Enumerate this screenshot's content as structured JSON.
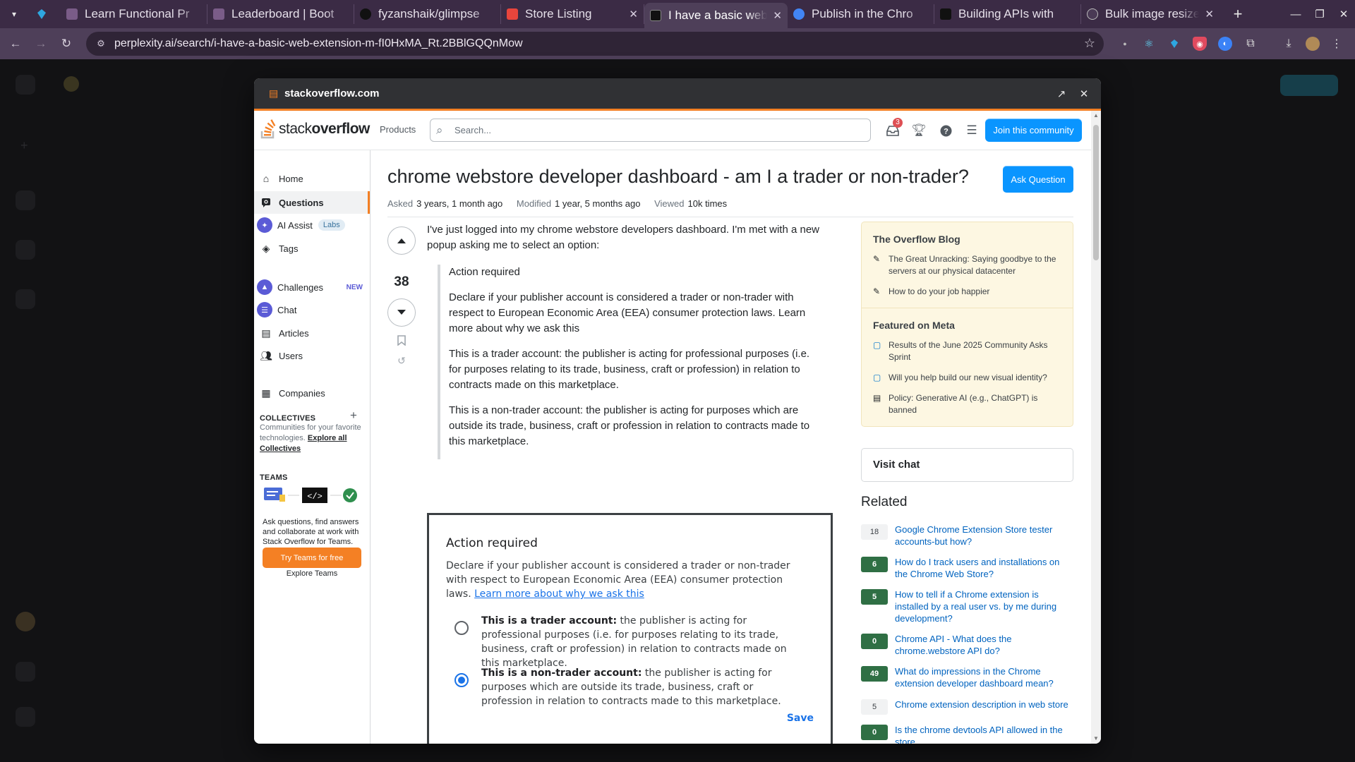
{
  "browser": {
    "tabs": [
      {
        "title": "Learn Functional Pr",
        "color": "#7a5c88"
      },
      {
        "title": "Leaderboard | Boot",
        "color": "#7a5c88"
      },
      {
        "title": "fyzanshaik/glimpse",
        "color": "#111111"
      },
      {
        "title": "Store Listing",
        "color": "#e8453c"
      },
      {
        "title": "I have a basic web",
        "color": "#111111"
      },
      {
        "title": "Publish in the Chro",
        "color": "#4285f4"
      },
      {
        "title": "Building APIs with",
        "color": "#111111"
      },
      {
        "title": "Bulk image resize t",
        "color": "#4a3a55"
      }
    ],
    "url": "perplexity.ai/search/i-have-a-basic-web-extension-m-fI0HxMA_Rt.2BBlGQQnMow"
  },
  "popup": {
    "domain": "stackoverflow.com"
  },
  "so": {
    "logo_left": "stack",
    "logo_right": "overflow",
    "products": "Products",
    "search_placeholder": "Search...",
    "inbox_count": "3",
    "join": "Join this community"
  },
  "nav": {
    "home": "Home",
    "questions": "Questions",
    "ai_assist": "AI Assist",
    "labs": "Labs",
    "tags": "Tags",
    "challenges": "Challenges",
    "new": "NEW",
    "chat": "Chat",
    "articles": "Articles",
    "users": "Users",
    "companies": "Companies",
    "collectives_title": "COLLECTIVES",
    "collectives_desc": "Communities for your favorite technologies.",
    "collectives_link": "Explore all Collectives",
    "teams_title": "TEAMS",
    "teams_desc": "Ask questions, find answers and collaborate at work with Stack Overflow for Teams.",
    "try_teams": "Try Teams for free",
    "explore_teams": "Explore Teams"
  },
  "question": {
    "title": "chrome webstore developer dashboard - am I a trader or non-trader?",
    "ask_button": "Ask Question",
    "asked_label": "Asked",
    "asked": "3 years, 1 month ago",
    "modified_label": "Modified",
    "modified": "1 year, 5 months ago",
    "viewed_label": "Viewed",
    "viewed": "10k times",
    "score": "38",
    "body_intro": "I've just logged into my chrome webstore developers dashboard. I'm met with a new popup asking me to select an option:",
    "quote": [
      "Action required",
      "Declare if your publisher account is considered a trader or non-trader with respect to European Economic Area (EEA) consumer protection laws. Learn more about why we ask this",
      "This is a trader account: the publisher is acting for professional purposes (i.e. for purposes relating to its trade, business, craft or profession) in relation to contracts made on this marketplace.",
      "This is a non-trader account: the publisher is acting for purposes which are outside its trade, business, craft or profession in relation to contracts made to this marketplace."
    ]
  },
  "screenshot": {
    "title": "Action required",
    "desc": "Declare if your publisher account is considered a trader or non-trader with respect to European Economic Area (EEA) consumer protection laws.",
    "link": "Learn more about why we ask this",
    "opt1_bold": "This is a trader account:",
    "opt1_rest": "the publisher is acting for professional purposes (i.e. for purposes relating to its trade, business, craft or profession) in relation to contracts made on this marketplace.",
    "opt2_bold": "This is a non-trader account:",
    "opt2_rest": "the publisher is acting for purposes which are outside its trade, business, craft or profession in relation to contracts made to this marketplace.",
    "save": "Save"
  },
  "sidebar": {
    "blog_title": "The Overflow Blog",
    "blog_items": [
      "The Great Unracking: Saying goodbye to the servers at our physical datacenter",
      "How to do your job happier"
    ],
    "meta_title": "Featured on Meta",
    "meta_items": [
      "Results of the June 2025 Community Asks Sprint",
      "Will you help build our new visual identity?",
      "Policy: Generative AI (e.g., ChatGPT) is banned"
    ],
    "visit_chat": "Visit chat",
    "related_title": "Related",
    "related": [
      {
        "count": "18",
        "title": "Google Chrome Extension Store tester accounts-but how?",
        "answered": false
      },
      {
        "count": "6",
        "title": "How do I track users and installations on the Chrome Web Store?",
        "answered": true
      },
      {
        "count": "5",
        "title": "How to tell if a Chrome extension is installed by a real user vs. by me during development?",
        "answered": true
      },
      {
        "count": "0",
        "title": "Chrome API - What does the chrome.webstore API do?",
        "answered": true
      },
      {
        "count": "49",
        "title": "What do impressions in the Chrome extension developer dashboard mean?",
        "answered": true
      },
      {
        "count": "5",
        "title": "Chrome extension description in web store",
        "answered": false
      },
      {
        "count": "0",
        "title": "Is the chrome devtools API allowed in the store",
        "answered": true
      }
    ]
  }
}
